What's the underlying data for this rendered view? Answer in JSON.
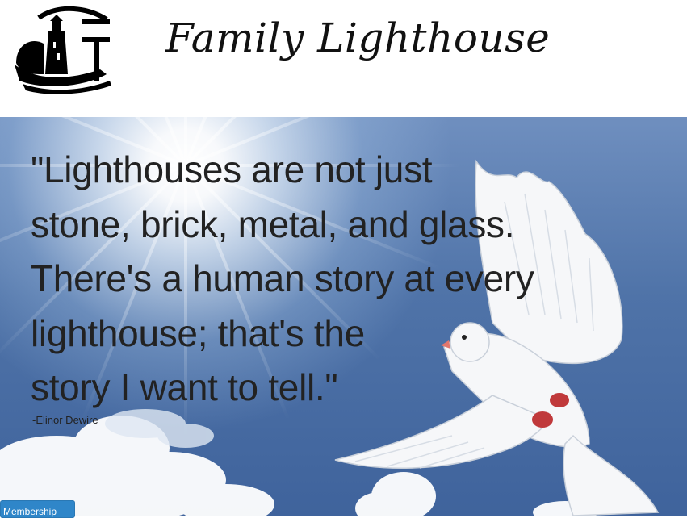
{
  "header": {
    "site_title": "Family Lighthouse",
    "logo_icon": "lighthouse-logo-icon"
  },
  "hero": {
    "quote_lines": [
      "\"Lighthouses are not just",
      "stone, brick, metal, and glass.",
      "There's a human story at every",
      "lighthouse; that's the",
      "story I want to tell.\""
    ],
    "attribution": "-Elinor Dewire",
    "image_subject": "dove-icon"
  },
  "buttons": {
    "membership_label": "Membership"
  },
  "colors": {
    "sky": "#4f73a8",
    "quote_text": "#222222",
    "button": "#2f86c9"
  }
}
